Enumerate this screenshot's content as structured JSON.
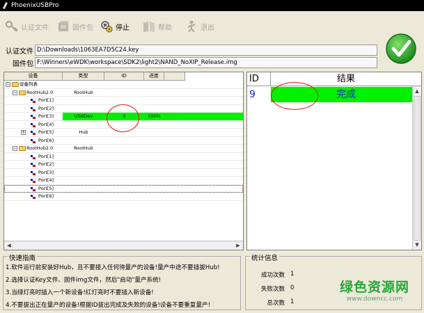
{
  "window": {
    "title": "PhoenixUSBPro"
  },
  "toolbar": {
    "certificate": "认证文件",
    "firmware": "固件包",
    "stop": "停止",
    "help": "帮助",
    "exit": "退出"
  },
  "fields": {
    "cert_label": "认证文件",
    "cert_value": "D:\\Downloads\\1063EA7D5C24.key",
    "firmware_label": "固件包",
    "firmware_value": "F:\\Winners\\eWDK\\workspace\\SDK2\\light2\\NAND_NoXIP_Release.img"
  },
  "device_table": {
    "headers": [
      "设备",
      "类型",
      "ID",
      "进度"
    ],
    "rows": [
      {
        "device": "设备列表",
        "type": "",
        "id": "",
        "progress": "",
        "level": 0,
        "kind": "root"
      },
      {
        "device": "RootHub2.0",
        "type": "RootHub",
        "id": "",
        "progress": "",
        "level": 1,
        "kind": "hub"
      },
      {
        "device": "Port[1]",
        "type": "",
        "id": "",
        "progress": "",
        "level": 2,
        "kind": "port"
      },
      {
        "device": "Port[2]",
        "type": "",
        "id": "",
        "progress": "",
        "level": 2,
        "kind": "port"
      },
      {
        "device": "Port[3]",
        "type": "USBDev",
        "id": "9",
        "progress": "100%",
        "level": 2,
        "kind": "port",
        "highlight": true
      },
      {
        "device": "Port[4]",
        "type": "",
        "id": "",
        "progress": "",
        "level": 2,
        "kind": "port"
      },
      {
        "device": "Port[5]",
        "type": "Hub",
        "id": "",
        "progress": "",
        "level": 2,
        "kind": "porthub"
      },
      {
        "device": "Port[6]",
        "type": "",
        "id": "",
        "progress": "",
        "level": 2,
        "kind": "port"
      },
      {
        "device": "RootHub2.0",
        "type": "RootHub",
        "id": "",
        "progress": "",
        "level": 1,
        "kind": "hub"
      },
      {
        "device": "Port[1]",
        "type": "",
        "id": "",
        "progress": "",
        "level": 2,
        "kind": "port"
      },
      {
        "device": "Port[2]",
        "type": "",
        "id": "",
        "progress": "",
        "level": 2,
        "kind": "port"
      },
      {
        "device": "Port[3]",
        "type": "",
        "id": "",
        "progress": "",
        "level": 2,
        "kind": "port"
      },
      {
        "device": "Port[4]",
        "type": "",
        "id": "",
        "progress": "",
        "level": 2,
        "kind": "port"
      },
      {
        "device": "Port[5]",
        "type": "",
        "id": "",
        "progress": "",
        "level": 2,
        "kind": "port",
        "selected": true
      },
      {
        "device": "Port[6]",
        "type": "",
        "id": "",
        "progress": "",
        "level": 2,
        "kind": "port"
      }
    ]
  },
  "result_table": {
    "header_id": "ID",
    "header_result": "结果",
    "rows": [
      {
        "id": "9",
        "result": "完成"
      }
    ]
  },
  "guide": {
    "title": "快速指南",
    "lines": [
      "1.软件运行前安装好Hub，且不要接入任何待量产的设备!量产中途不要插拔Hub!",
      "2.选择认证Key文件、固件img文件，然后\"启动\"量产系统!",
      "3.当绿灯亮时插入一个新设备!红灯亮时不要插入新设备!",
      "4.不要拔出正在量产的设备!根据ID拔出完成及失败的设备!设备不要重复量产!"
    ]
  },
  "stats": {
    "title": "统计信息",
    "success_label": "成功次数",
    "success_value": "1",
    "fail_label": "失败次数",
    "fail_value": "0",
    "total_label": "总次数",
    "total_value": "1"
  },
  "watermark": {
    "line1": "绿色资源网",
    "line2": "www.downcc.com"
  },
  "colors": {
    "highlight": "#00f000",
    "annotation": "#e01818",
    "id_text": "#1020d0"
  }
}
